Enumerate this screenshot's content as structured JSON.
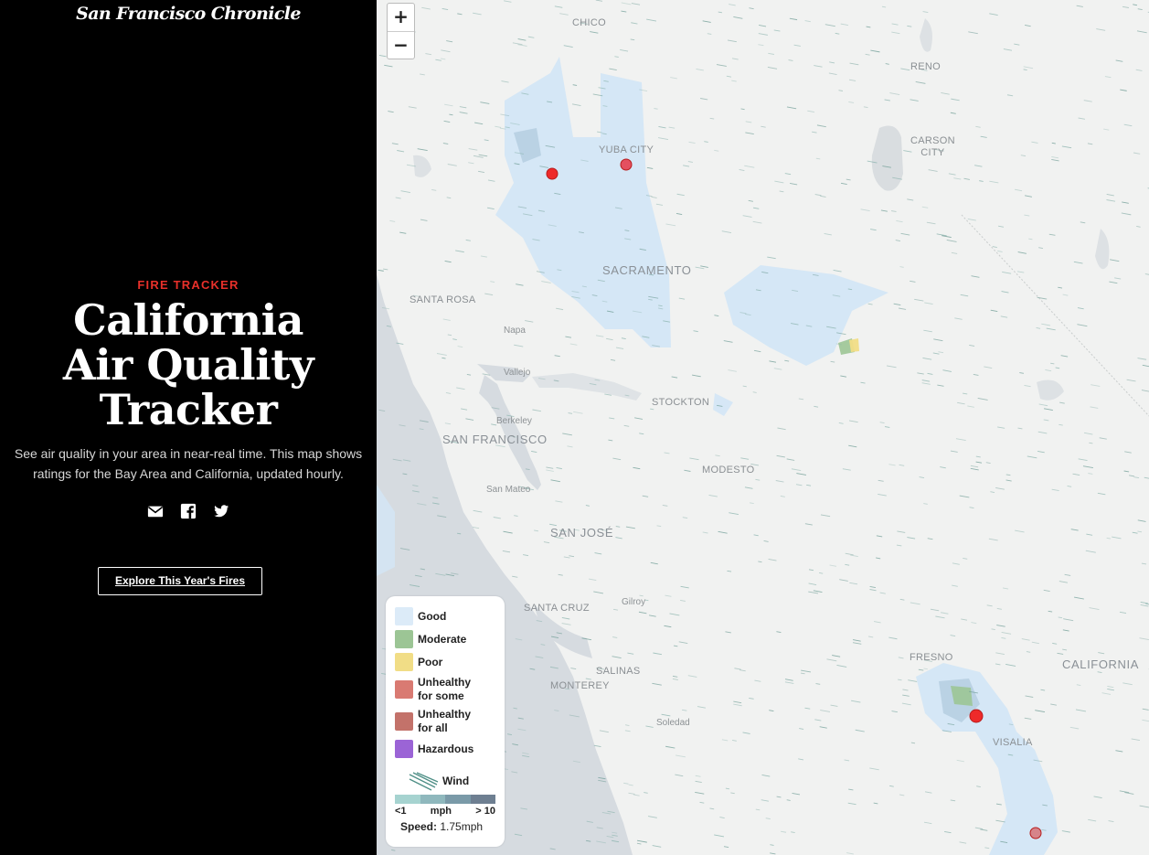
{
  "sidebar": {
    "masthead": "San Francisco Chronicle",
    "kicker": "FIRE TRACKER",
    "headline_lines": [
      "California",
      "Air Quality",
      "Tracker"
    ],
    "dek": "See air quality in your area in near-real time. This map shows ratings for the Bay Area and California, updated hourly.",
    "share_icons": [
      "email-icon",
      "facebook-icon",
      "twitter-icon"
    ],
    "explore_button": "Explore This Year's Fires"
  },
  "map": {
    "zoom_in": "+",
    "zoom_out": "−",
    "places": {
      "chico": "CHICO",
      "reno": "RENO",
      "yuba_city": "YUBA CITY",
      "carson_city": "CARSON\nCITY",
      "sacramento": "SACRAMENTO",
      "santa_rosa": "SANTA ROSA",
      "napa": "Napa",
      "vallejo": "Vallejo",
      "stockton": "STOCKTON",
      "berkeley": "Berkeley",
      "san_francisco": "SAN FRANCISCO",
      "modesto": "MODESTO",
      "san_mateo": "San Mateo",
      "san_jose": "SAN JOSÉ",
      "santa_cruz": "SANTA CRUZ",
      "gilroy": "Gilroy",
      "salinas": "SALINAS",
      "monterey": "MONTEREY",
      "soledad": "Soledad",
      "fresno": "FRESNO",
      "california": "CALIFORNIA",
      "visalia": "VISALIA"
    },
    "colors": {
      "water": "#d6dbe0",
      "land": "#f1f2f1",
      "good": "#d3e6f6",
      "moderate": "#9cc595",
      "poor": "#f1dd86",
      "unhealthy_some": "#d97a72",
      "unhealthy_all": "#c3726a",
      "hazardous": "#9b64d6",
      "fire": "#ee2a2a"
    }
  },
  "legend": {
    "items": [
      {
        "label": "Good",
        "color": "#dcebf8"
      },
      {
        "label": "Moderate",
        "color": "#9cc595"
      },
      {
        "label": "Poor",
        "color": "#f1dd86"
      },
      {
        "label": "Unhealthy\nfor some",
        "color": "#d97a72"
      },
      {
        "label": "Unhealthy\nfor all",
        "color": "#c3726a"
      },
      {
        "label": "Hazardous",
        "color": "#9b64d6"
      }
    ],
    "wind_label": "Wind",
    "wind_scale_colors": [
      "#a6d3d0",
      "#8fb8bd",
      "#7a9aa8",
      "#6e7f91"
    ],
    "wind_min": "<1",
    "wind_unit": "mph",
    "wind_max": "> 10",
    "speed_label": "Speed:",
    "speed_value": "1.75mph"
  }
}
